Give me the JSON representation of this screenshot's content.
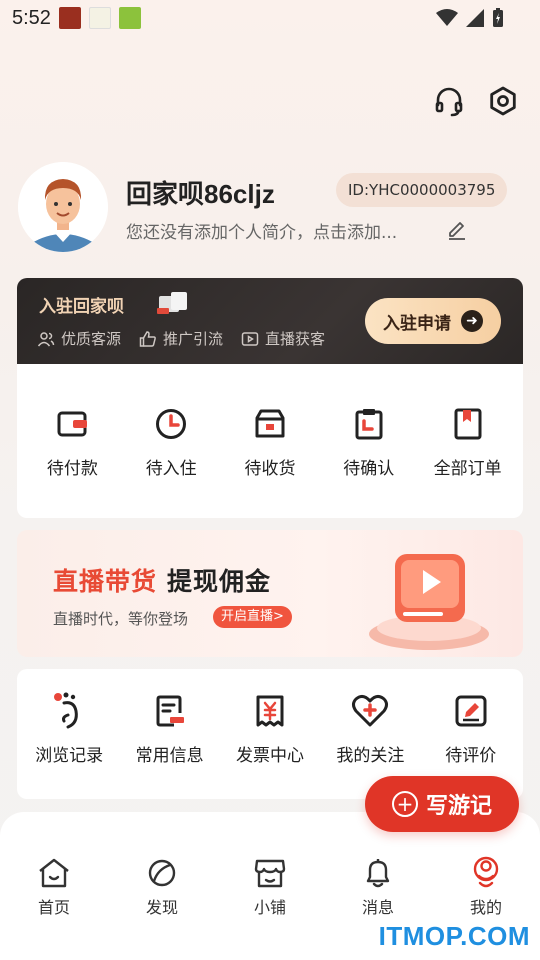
{
  "status": {
    "time": "5:52"
  },
  "profile": {
    "username": "回家呗86cljz",
    "id_label": "ID:YHC0000003795",
    "bio": "您还没有添加个人简介，点击添加..."
  },
  "join": {
    "title": "入驻回家呗",
    "features": [
      "优质客源",
      "推广引流",
      "直播获客"
    ],
    "button": "入驻申请"
  },
  "orders": [
    {
      "label": "待付款",
      "icon": "wallet-icon"
    },
    {
      "label": "待入住",
      "icon": "clock-icon"
    },
    {
      "label": "待收货",
      "icon": "package-icon"
    },
    {
      "label": "待确认",
      "icon": "clipboard-icon"
    },
    {
      "label": "全部订单",
      "icon": "bookmark-doc-icon"
    }
  ],
  "live": {
    "title_red": "直播带货",
    "title_dark": "提现佣金",
    "subtitle": "直播时代，等你登场",
    "button": "开启直播>"
  },
  "services": [
    {
      "label": "浏览记录",
      "icon": "footprint-icon"
    },
    {
      "label": "常用信息",
      "icon": "info-doc-icon"
    },
    {
      "label": "发票中心",
      "icon": "invoice-icon"
    },
    {
      "label": "我的关注",
      "icon": "heart-plus-icon"
    },
    {
      "label": "待评价",
      "icon": "review-icon"
    }
  ],
  "write_button": "写游记",
  "tabs": [
    {
      "label": "首页",
      "icon": "home-icon"
    },
    {
      "label": "发现",
      "icon": "discover-icon"
    },
    {
      "label": "小铺",
      "icon": "shop-icon"
    },
    {
      "label": "消息",
      "icon": "bell-icon"
    },
    {
      "label": "我的",
      "icon": "profile-icon",
      "active": true
    }
  ],
  "watermark": "ITMOP.COM",
  "colors": {
    "accent": "#e03527",
    "gold": "#f1d3b4",
    "dark_banner": "#2a2625"
  }
}
